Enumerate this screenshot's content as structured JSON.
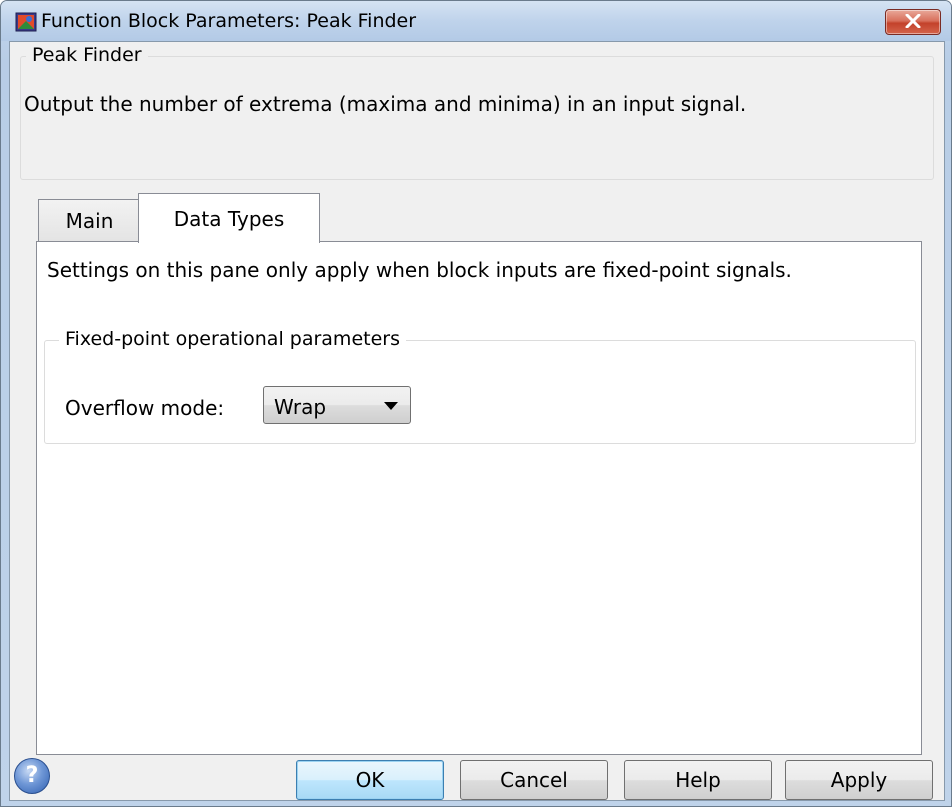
{
  "window": {
    "title": "Function Block Parameters: Peak Finder"
  },
  "description": {
    "group_title": "Peak Finder",
    "text": "Output the number of extrema (maxima and minima) in an input signal."
  },
  "tabs": [
    {
      "label": "Main",
      "active": false
    },
    {
      "label": "Data Types",
      "active": true
    }
  ],
  "panel": {
    "note": "Settings on this pane only apply when block inputs are fixed-point signals.",
    "fixed_point_group": {
      "title": "Fixed-point operational parameters",
      "overflow_label": "Overflow mode:",
      "overflow_value": "Wrap"
    }
  },
  "buttons": {
    "help_icon": "?",
    "ok": "OK",
    "cancel": "Cancel",
    "help": "Help",
    "apply": "Apply"
  },
  "colors": {
    "title_bar": "#bfd3eb",
    "close_button": "#c3422b",
    "default_button_border": "#3c7fb1"
  }
}
